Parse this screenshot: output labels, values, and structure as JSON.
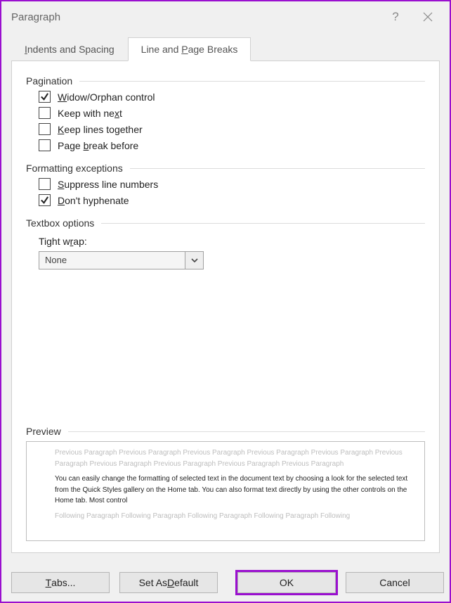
{
  "window": {
    "title": "Paragraph"
  },
  "tabs": {
    "indents_pre": "I",
    "indents_rest": "ndents and Spacing",
    "breaks_pre": "Line and ",
    "breaks_u": "P",
    "breaks_rest": "age Breaks"
  },
  "groups": {
    "pagination": "Pagination",
    "formatting": "Formatting exceptions",
    "textbox": "Textbox options",
    "preview": "Preview"
  },
  "checks": {
    "widow": {
      "checked": true,
      "u": "W",
      "rest": "idow/Orphan control"
    },
    "keep_next": {
      "checked": false,
      "pre": "Keep with ne",
      "u": "x",
      "rest": "t"
    },
    "keep_lines": {
      "checked": false,
      "u": "K",
      "rest": "eep lines together"
    },
    "page_break": {
      "checked": false,
      "pre": "Page ",
      "u": "b",
      "rest": "reak before"
    },
    "suppress": {
      "checked": false,
      "u": "S",
      "rest": "uppress line numbers"
    },
    "no_hyphen": {
      "checked": true,
      "u": "D",
      "rest": "on't hyphenate"
    }
  },
  "tight_wrap": {
    "label_pre": "Tight w",
    "label_u": "r",
    "label_rest": "ap:",
    "value": "None"
  },
  "preview": {
    "prev_text": "Previous Paragraph Previous Paragraph Previous Paragraph Previous Paragraph Previous Paragraph Previous Paragraph Previous Paragraph Previous Paragraph Previous Paragraph Previous Paragraph",
    "body_text": "You can easily change the formatting of selected text in the document text by choosing a look for the selected text from the Quick Styles gallery on the Home tab. You can also format text directly by using the other controls on the Home tab. Most control",
    "follow_text": "Following Paragraph Following Paragraph Following Paragraph Following Paragraph Following"
  },
  "buttons": {
    "tabs_u": "T",
    "tabs_rest": "abs...",
    "default_pre": "Set As ",
    "default_u": "D",
    "default_rest": "efault",
    "ok": "OK",
    "cancel": "Cancel"
  }
}
